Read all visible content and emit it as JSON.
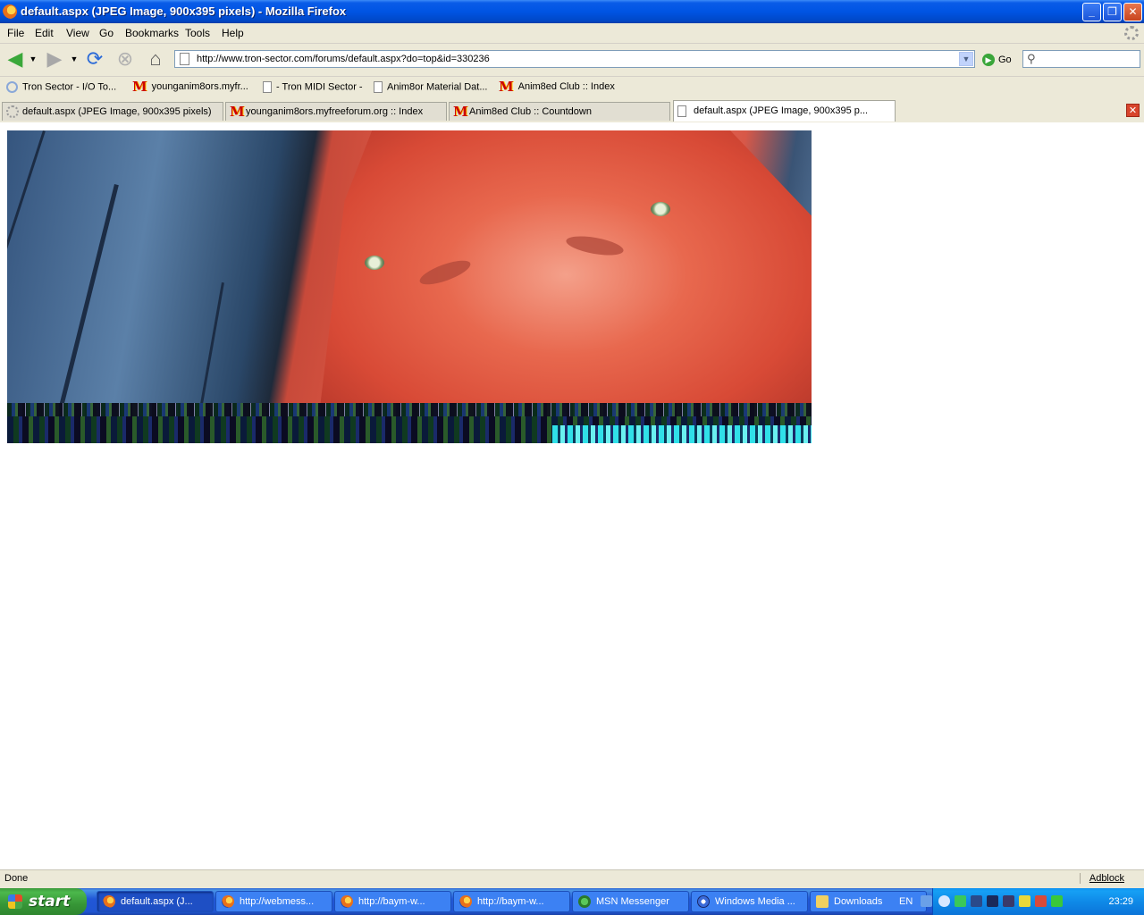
{
  "window": {
    "title": "default.aspx (JPEG Image, 900x395 pixels) - Mozilla Firefox",
    "minimize_glyph": "_",
    "maximize_glyph": "❐",
    "close_glyph": "✕"
  },
  "menu": [
    "File",
    "Edit",
    "View",
    "Go",
    "Bookmarks",
    "Tools",
    "Help"
  ],
  "nav": {
    "back_icon": "back-arrow-icon",
    "forward_icon": "forward-arrow-icon",
    "reload_icon": "reload-icon",
    "stop_icon": "stop-icon",
    "home_icon": "home-icon",
    "url": "http://www.tron-sector.com/forums/default.aspx?do=top&id=330236",
    "go_label": "Go",
    "search_value": ""
  },
  "bookmarks": [
    {
      "label": "Tron Sector - I/O To...",
      "icon": "ring-icon"
    },
    {
      "label": "younganim8ors.myfr...",
      "icon": "m-icon"
    },
    {
      "label": "- Tron MIDI Sector -",
      "icon": "doc-icon"
    },
    {
      "label": "Anim8or Material Dat...",
      "icon": "doc-icon"
    },
    {
      "label": "Anim8ed Club :: Index",
      "icon": "m-icon"
    }
  ],
  "tabs": [
    {
      "label": "default.aspx (JPEG Image, 900x395 pixels)",
      "icon": "loading-icon",
      "active": false
    },
    {
      "label": "younganim8ors.myfreeforum.org :: Index",
      "icon": "m-icon",
      "active": false
    },
    {
      "label": "Anim8ed Club :: Countdown",
      "icon": "m-icon",
      "active": false
    },
    {
      "label": "default.aspx (JPEG Image, 900x395 p...",
      "icon": "doc-icon",
      "active": true
    }
  ],
  "status": {
    "text": "Done",
    "adblock": "Adblock"
  },
  "taskbar": {
    "start_label": "start",
    "tasks": [
      {
        "label": "default.aspx (J...",
        "icon": "firefox-icon",
        "active": true
      },
      {
        "label": "http://webmess...",
        "icon": "firefox-icon",
        "active": false
      },
      {
        "label": "http://baym-w...",
        "icon": "firefox-icon",
        "active": false
      },
      {
        "label": "http://baym-w...",
        "icon": "firefox-icon",
        "active": false
      },
      {
        "label": "MSN Messenger",
        "icon": "msn-icon",
        "active": false
      },
      {
        "label": "Windows Media ...",
        "icon": "media-player-icon",
        "active": false
      },
      {
        "label": "Downloads",
        "icon": "folder-icon",
        "active": false
      }
    ],
    "language": "EN",
    "clock": "23:29"
  },
  "colors": {
    "titlebar": "#0054e3",
    "taskbar": "#2157d7",
    "start": "#379637",
    "tray": "#0f8ae8",
    "chrome": "#ece9d8"
  }
}
